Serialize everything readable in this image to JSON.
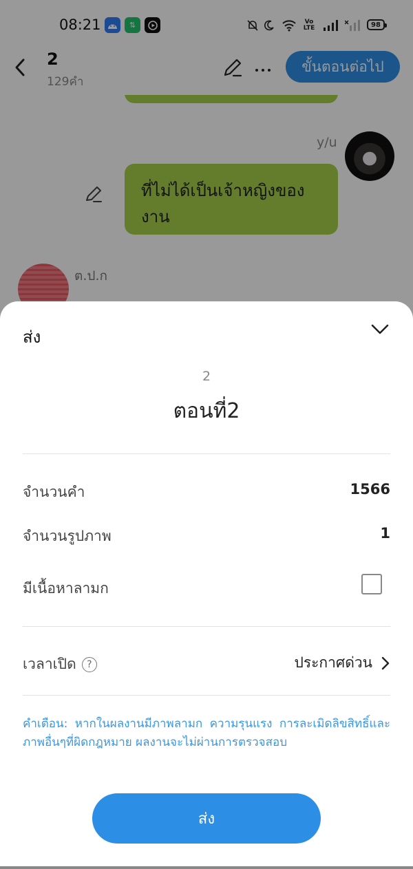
{
  "status_bar": {
    "time": "08:21",
    "battery": "98",
    "net_label": "Vo LTE"
  },
  "header": {
    "title": "2",
    "word_count": "129คำ",
    "next_button": "ขั้นตอนต่อไป"
  },
  "chat": {
    "sender_right": "y/u",
    "message": "ที่ไม่ได้เป็นเจ้าหญิงของงาน",
    "sender_left": "ต.ป.ก"
  },
  "sheet": {
    "title": "ส่ง",
    "episode_number": "2",
    "episode_title": "ตอนที่2",
    "rows": [
      {
        "label": "จำนวนคำ",
        "value": "1566"
      },
      {
        "label": "จำนวนรูปภาพ",
        "value": "1"
      },
      {
        "label": "มีเนื้อหาลามก"
      }
    ],
    "mature_checked": false,
    "publish_time_label": "เวลาเปิด",
    "help_icon": "?",
    "publish_time_value": "ประกาศด่วน",
    "warning": "คำเตือน: หากในผลงานมีภาพลามก ความรุนแรง การละเมิดลิขสิทธิ์และภาพอื่นๆที่ผิดกฎหมาย ผลงานจะไม่ผ่านการตรวจสอบ",
    "submit_button": "ส่ง"
  },
  "colors": {
    "accent": "#2d8ee6",
    "bubble": "#a7d14a",
    "warning_text": "#3b97e0",
    "overlay": "rgba(0,0,0,0.40)"
  },
  "icons": [
    "back-arrow-icon",
    "pencil-icon",
    "more-dots-icon",
    "chevron-down-icon",
    "chevron-right-icon",
    "help-circle-icon"
  ]
}
